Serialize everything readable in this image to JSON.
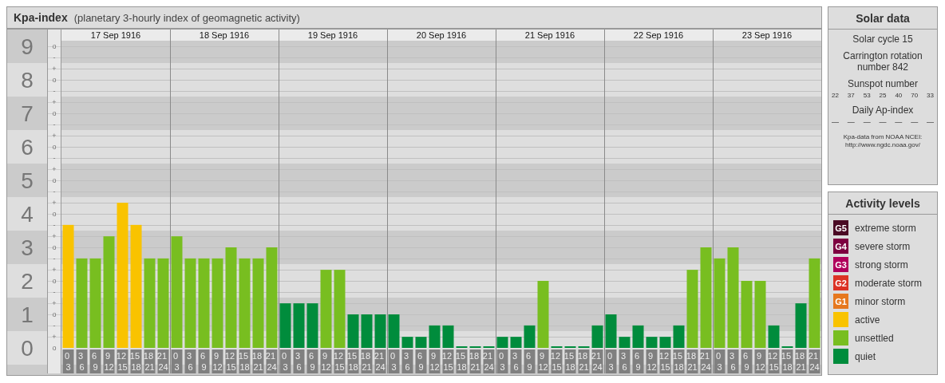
{
  "title": {
    "name": "Kpa-index",
    "subtitle": "(planetary 3-hourly index of geomagnetic activity)"
  },
  "chart": {
    "days": [
      "17 Sep 1916",
      "18 Sep 1916",
      "19 Sep 1916",
      "20 Sep 1916",
      "21 Sep 1916",
      "22 Sep 1916",
      "23 Sep 1916"
    ],
    "sub_ticks": [
      "o",
      "-",
      "+",
      "o",
      "-",
      "+",
      "o",
      "-",
      "+",
      "o",
      "-",
      "+",
      "o",
      "-",
      "+",
      "o",
      "-",
      "+",
      "o",
      "-",
      "+",
      "o",
      "-",
      "+",
      "o",
      "-",
      "+",
      "o"
    ],
    "chart_data": {
      "type": "bar",
      "grid": true,
      "ylim": [
        0,
        9
      ],
      "yticks": [
        0,
        1,
        2,
        3,
        4,
        5,
        6,
        7,
        8,
        9
      ],
      "categories": [
        "0 3",
        "3 6",
        "6 9",
        "9 12",
        "12 15",
        "15 18",
        "18 21",
        "21 24",
        "0 3",
        "3 6",
        "6 9",
        "9 12",
        "12 15",
        "15 18",
        "18 21",
        "21 24",
        "0 3",
        "3 6",
        "6 9",
        "9 12",
        "12 15",
        "15 18",
        "18 21",
        "21 24",
        "0 3",
        "3 6",
        "6 9",
        "9 12",
        "12 15",
        "15 18",
        "18 21",
        "21 24",
        "0 3",
        "3 6",
        "6 9",
        "9 12",
        "12 15",
        "15 18",
        "18 21",
        "21 24",
        "0 3",
        "3 6",
        "6 9",
        "9 12",
        "12 15",
        "15 18",
        "18 21",
        "21 24",
        "0 3",
        "3 6",
        "6 9",
        "9 12",
        "12 15",
        "15 18",
        "18 21",
        "21 24"
      ],
      "series": [
        {
          "name": "active",
          "color": "#f9c300",
          "values": [
            3.67,
            null,
            null,
            null,
            4.33,
            3.67,
            null,
            null,
            null,
            null,
            null,
            null,
            null,
            null,
            null,
            null,
            null,
            null,
            null,
            null,
            null,
            null,
            null,
            null,
            null,
            null,
            null,
            null,
            null,
            null,
            null,
            null,
            null,
            null,
            null,
            null,
            null,
            null,
            null,
            null,
            null,
            null,
            null,
            null,
            null,
            null,
            null,
            null,
            null,
            null,
            null,
            null,
            null,
            null,
            null,
            null
          ]
        },
        {
          "name": "unsettled",
          "color": "#78be20",
          "values": [
            null,
            2.67,
            2.67,
            3.33,
            null,
            null,
            2.67,
            2.67,
            3.33,
            2.67,
            2.67,
            2.67,
            3,
            2.67,
            2.67,
            3,
            null,
            null,
            null,
            2.33,
            2.33,
            null,
            null,
            null,
            null,
            null,
            null,
            null,
            null,
            null,
            null,
            null,
            null,
            null,
            null,
            2,
            null,
            null,
            null,
            null,
            null,
            null,
            null,
            null,
            null,
            null,
            2.33,
            3,
            2.67,
            3,
            2,
            2,
            null,
            null,
            null,
            2.67
          ]
        },
        {
          "name": "quiet",
          "color": "#008c3c",
          "values": [
            null,
            null,
            null,
            null,
            null,
            null,
            null,
            null,
            null,
            null,
            null,
            null,
            null,
            null,
            null,
            null,
            1.33,
            1.33,
            1.33,
            null,
            null,
            1,
            1,
            1,
            1,
            0.33,
            0.33,
            0.67,
            0.67,
            0,
            0,
            0,
            0.33,
            0.33,
            0.67,
            null,
            0,
            0,
            0,
            0.67,
            1,
            0.33,
            0.67,
            0.33,
            0.33,
            0.67,
            null,
            null,
            null,
            null,
            null,
            null,
            0.67,
            0,
            1.33,
            null
          ]
        }
      ]
    }
  },
  "solar_data": {
    "title": "Solar data",
    "solar_cycle": "Solar cycle 15",
    "carrington": "Carrington rotation number 842",
    "sunspot_label": "Sunspot number",
    "sunspot_numbers": [
      "22",
      "37",
      "53",
      "25",
      "40",
      "70",
      "33"
    ],
    "ap_label": "Daily Ap-index",
    "ap_values": [
      "—",
      "—",
      "—",
      "—",
      "—",
      "—",
      "—"
    ],
    "source": "Kpa-data from NOAA NCEI: http://www.ngdc.noaa.gov/"
  },
  "activity_levels": {
    "title": "Activity levels",
    "items": [
      {
        "badge": "G5",
        "label": "extreme storm",
        "color": "#4a0a24"
      },
      {
        "badge": "G4",
        "label": "severe storm",
        "color": "#7d0040"
      },
      {
        "badge": "G3",
        "label": "strong storm",
        "color": "#b0005c"
      },
      {
        "badge": "G2",
        "label": "moderate storm",
        "color": "#dc3224"
      },
      {
        "badge": "G1",
        "label": "minor storm",
        "color": "#e6781e"
      }
    ]
  }
}
